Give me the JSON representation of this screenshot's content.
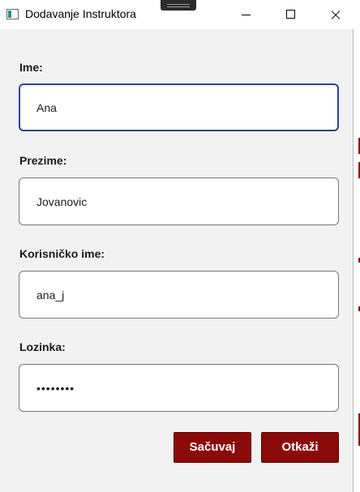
{
  "window": {
    "title": "Dodavanje Instruktora"
  },
  "icons": {
    "app": "app-window-icon",
    "minimize": "minimize-icon",
    "maximize": "maximize-icon",
    "close": "close-icon"
  },
  "form": {
    "first_name": {
      "label": "Ime:",
      "value": "Ana"
    },
    "last_name": {
      "label": "Prezime:",
      "value": "Jovanovic"
    },
    "username": {
      "label": "Korisničko ime:",
      "value": "ana_j"
    },
    "password": {
      "label": "Lozinka:",
      "value": "••••••••"
    }
  },
  "buttons": {
    "save_label": "Sačuvaj",
    "cancel_label": "Otkaži"
  },
  "colors": {
    "button_bg": "#8b0a0a",
    "focus_border": "#2f3f9a",
    "window_bg": "#f2f2f2"
  }
}
